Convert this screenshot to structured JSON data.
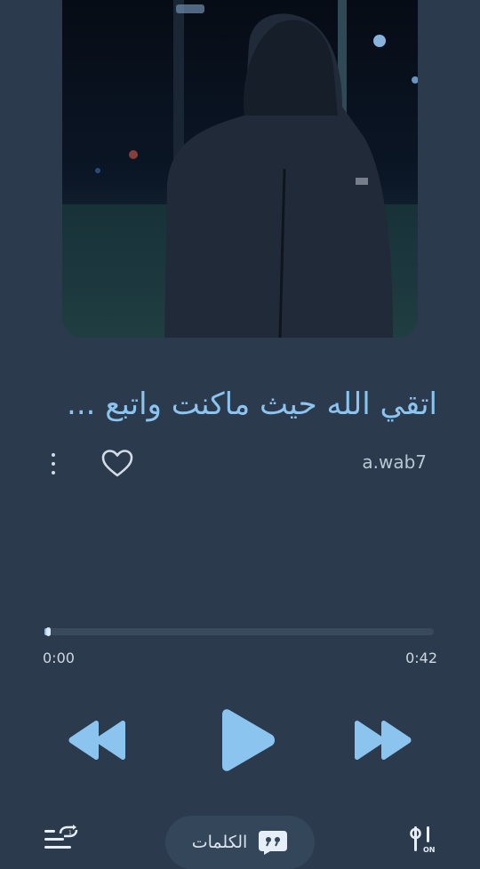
{
  "track": {
    "title": "اتقي الله حيث ماكنت واتبع ...",
    "artist": "a.wab7"
  },
  "progress": {
    "current": "0:00",
    "duration": "0:42",
    "fraction": 0.01
  },
  "bottom_bar": {
    "lyrics_label": "الكلمات",
    "equalizer_badge": "ON"
  },
  "colors": {
    "background": "#2b3a4c",
    "accent": "#8cc4f0",
    "track": "#3a4a5d",
    "pill": "#34465a"
  },
  "icons": {
    "more": "more-vertical-icon",
    "like": "heart-outline-icon",
    "prev": "rewind-icon",
    "play": "play-icon",
    "next": "fast-forward-icon",
    "queue": "queue-repeat-icon",
    "lyrics": "quote-bubble-icon",
    "equalizer": "equalizer-icon"
  }
}
